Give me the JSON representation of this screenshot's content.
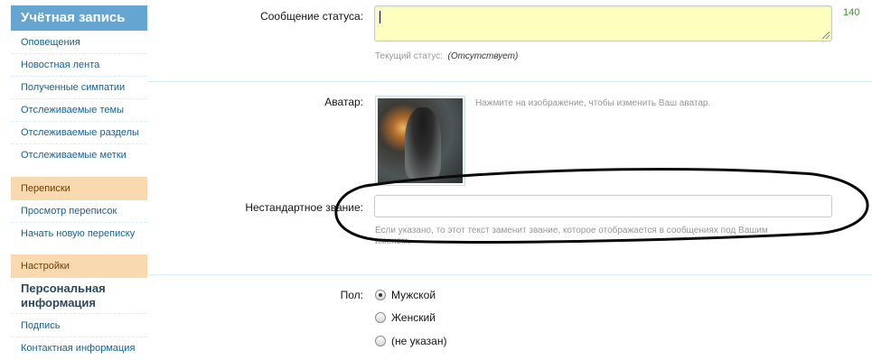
{
  "sidebar": {
    "header": "Учётная запись",
    "items_main": [
      "Оповещения",
      "Новостная лента",
      "Полученные симпатии",
      "Отслеживаемые темы",
      "Отслеживаемые разделы",
      "Отслеживаемые метки"
    ],
    "section_messages": "Переписки",
    "items_messages": [
      "Просмотр переписок",
      "Начать новую переписку"
    ],
    "section_settings": "Настройки",
    "personal_info": "Персональная информация",
    "items_settings": [
      "Подпись",
      "Контактная информация"
    ]
  },
  "form": {
    "status_label": "Сообщение статуса:",
    "status_value": "",
    "status_counter": "140",
    "current_status_label": "Текущий статус:",
    "current_status_value": "(Отсутствует)",
    "avatar_label": "Аватар:",
    "avatar_hint": "Нажмите на изображение, чтобы изменить Ваш аватар.",
    "custom_title_label": "Нестандартное звание:",
    "custom_title_value": "",
    "custom_title_hint_1": "Если указано, то этот текст заменит звание, которое отображается в сообщениях под Вашим",
    "custom_title_hint_2": "именем.",
    "gender_label": "Пол:",
    "gender_options": [
      "Мужской",
      "Женский",
      "(не указан)"
    ],
    "gender_selected": "Мужской"
  },
  "colors": {
    "sidebar_header_bg": "#65a5d1",
    "section_bg": "#f9d9b0",
    "link": "#176093",
    "status_bg": "#fefebe",
    "counter": "#3b8d2f"
  }
}
